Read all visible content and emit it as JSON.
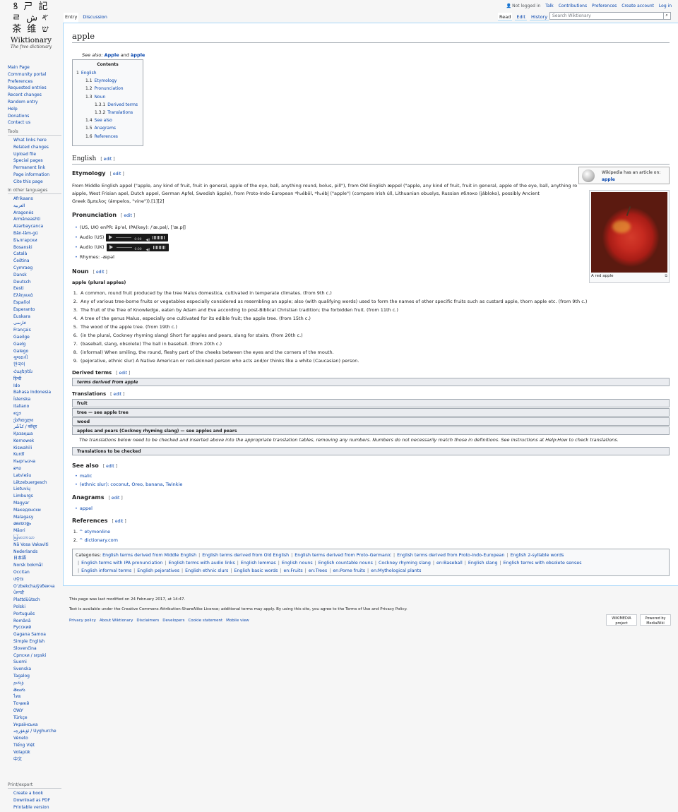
{
  "logo": {
    "glyphs1": "ꝸ ㄕ 記",
    "glyphs2": "ㄹ 𐤀 ش",
    "glyphs3": "茶 维 ש",
    "title": "Wiktionary",
    "subtitle": "The free dictionary"
  },
  "nav": [
    "Main Page",
    "Community portal",
    "Preferences",
    "Requested entries",
    "Recent changes",
    "Random entry",
    "Help",
    "Donations",
    "Contact us"
  ],
  "tools": {
    "heading": "Tools",
    "items": [
      "What links here",
      "Related changes",
      "Upload file",
      "Special pages",
      "Permanent link",
      "Page information",
      "Cite this page"
    ]
  },
  "languages": {
    "heading": "In other languages",
    "items": [
      "Afrikaans",
      "العربية",
      "Aragonés",
      "Armãneashti",
      "Azərbaycanca",
      "Bân-lâm-gú",
      "Български",
      "Bosanski",
      "Català",
      "Čeština",
      "Cymraeg",
      "Dansk",
      "Deutsch",
      "Eesti",
      "Ελληνικά",
      "Español",
      "Esperanto",
      "Euskara",
      "فارسی",
      "Français",
      "Gaeilge",
      "Gaelg",
      "Galego",
      "ગુજરાતી",
      "한국어",
      "Հայերեն",
      "हिन्दी",
      "Ido",
      "Bahasa Indonesia",
      "Íslenska",
      "Italiano",
      "ಕನ್ನಡ",
      "ქართული",
      "کٲشُر / कॉशुर",
      "Қазақша",
      "Kernowek",
      "Kiswahili",
      "Kurdî",
      "Кыргызча",
      "ລາວ",
      "Latviešu",
      "Lëtzebuergesch",
      "Lietuvių",
      "Limburgs",
      "Magyar",
      "Македонски",
      "Malagasy",
      "മലയാളം",
      "Māori",
      "မြန်မာဘာသာ",
      "Nā Vosa Vakaviti",
      "Nederlands",
      "日本語",
      "Norsk bokmål",
      "Occitan",
      "ଓଡ଼ିଆ",
      "Oʻzbekcha/ўзбекча",
      "ਪੰਜਾਬੀ",
      "Plattdüütsch",
      "Polski",
      "Português",
      "Română",
      "Русский",
      "Gagana Samoa",
      "Simple English",
      "Slovenčina",
      "Српски / srpski",
      "Suomi",
      "Svenska",
      "Tagalog",
      "தமிழ்",
      "తెలుగు",
      "ไทย",
      "Тоҷикӣ",
      "ᏣᎳᎩ",
      "Türkçe",
      "Українська",
      "ئۇيغۇرچە / Uyghurche",
      "Vèneto",
      "Tiếng Việt",
      "Volapük",
      "中文"
    ]
  },
  "print": {
    "heading": "Print/export",
    "items": [
      "Create a book",
      "Download as PDF",
      "Printable version"
    ]
  },
  "personal": {
    "not_logged": "Not logged in",
    "talk": "Talk",
    "contributions": "Contributions",
    "preferences": "Preferences",
    "create": "Create account",
    "login": "Log in"
  },
  "tabs": {
    "entry": "Entry",
    "discussion": "Discussion",
    "read": "Read",
    "edit": "Edit",
    "history": "History"
  },
  "search_placeholder": "Search Wiktionary",
  "page_title": "apple",
  "see_also_prefix": "See also:",
  "see_also_1": "Apple",
  "see_also_and": "and",
  "see_also_2": "àpple",
  "toc": {
    "title": "Contents",
    "items": [
      {
        "num": "1",
        "label": "English",
        "level": 1
      },
      {
        "num": "1.1",
        "label": "Etymology",
        "level": 2
      },
      {
        "num": "1.2",
        "label": "Pronunciation",
        "level": 2
      },
      {
        "num": "1.3",
        "label": "Noun",
        "level": 2
      },
      {
        "num": "1.3.1",
        "label": "Derived terms",
        "level": 3
      },
      {
        "num": "1.3.2",
        "label": "Translations",
        "level": 3
      },
      {
        "num": "1.4",
        "label": "See also",
        "level": 2
      },
      {
        "num": "1.5",
        "label": "Anagrams",
        "level": 2
      },
      {
        "num": "1.6",
        "label": "References",
        "level": 2
      }
    ]
  },
  "edit_label": "edit",
  "h_english": "English",
  "h_etymology": "Etymology",
  "etym_line1": "From Middle English appel (\"apple, any kind of fruit, fruit in general, apple of the eye, ball, anything round, bolus, pill\"), from Old English æppel (\"apple, any kind of fruit, fruit in general, apple of the eye, ball, anything round, bolus, pill\"), from Proto-Germanic *aplaz (\"apple\") (compare Scots",
  "etym_line2": "aipple, West Frisian apel, Dutch appel, German Apfel, Swedish äpple), from Proto-Indo-European *h₂ébōl, *h₂ébl̥ (\"apple\") (compare Irish úll, Lithuanian obuolys, Russian яблоко (jábloko), possibly Ancient",
  "etym_line3": "Greek ἄμπελος (ámpelos, \"vine\")).[1][2]",
  "wikibox": {
    "text": "Wikipedia has an article on:",
    "link": "apple"
  },
  "thumb_caption": "A red apple",
  "h_pron": "Pronunciation",
  "pron_ipa": "(US, UK) enPR: ăp'əl, IPA(key): /ˈæ.pəl/, [ˈæ.pl̩]",
  "audio_label": "Audio",
  "audio_us": "(US)",
  "audio_uk": "(UK)",
  "audio_time": "0:00",
  "rhymes": "Rhymes: -æpəl",
  "h_noun": "Noun",
  "headword": "apple (plural apples)",
  "defs": [
    "A common, round fruit produced by the tree Malus domestica, cultivated in temperate climates. (from 9th c.)",
    "Any of various tree-borne fruits or vegetables especially considered as resembling an apple; also (with qualifying words) used to form the names of other specific fruits such as custard apple, thorn apple etc. (from 9th c.)",
    "The fruit of the Tree of Knowledge, eaten by Adam and Eve according to post-Biblical Christian tradition; the forbidden fruit. (from 11th c.)",
    "A tree of the genus Malus, especially one cultivated for its edible fruit; the apple tree. (from 15th c.)",
    "The wood of the apple tree. (from 19th c.)",
    "(in the plural, Cockney rhyming slang) Short for apples and pears, slang for stairs. (from 20th c.)",
    "(baseball, slang, obsolete) The ball in baseball. (from 20th c.)",
    "(informal) When smiling, the round, fleshy part of the cheeks between the eyes and the corners of the mouth.",
    "(pejorative, ethnic slur) A Native American or red-skinned person who acts and/or thinks like a white (Caucasian) person."
  ],
  "h_derived": "Derived terms",
  "derived_box": "terms derived from apple",
  "h_trans": "Translations",
  "trans_boxes": [
    "fruit",
    "tree — see apple tree",
    "wood",
    "apples and pears (Cockney rhyming slang) — see apples and pears"
  ],
  "trans_note": "The translations below need to be checked and inserted above into the appropriate translation tables, removing any numbers. Numbers do not necessarily match those in definitions. See instructions at Help:How to check translations.",
  "trans_check": "Translations to be checked",
  "h_seealso": "See also",
  "seealso_items": [
    "malic",
    "(ethnic slur): coconut, Oreo, banana, Twinkie"
  ],
  "h_anagrams": "Anagrams",
  "anagrams": [
    "appel"
  ],
  "h_refs": "References",
  "refs": [
    "^ etymonline",
    "^ dictionary.com"
  ],
  "categories": {
    "label": "Categories:",
    "row1": [
      "English terms derived from Middle English",
      "English terms derived from Old English",
      "English terms derived from Proto-Germanic",
      "English terms derived from Proto-Indo-European",
      "English 2-syllable words"
    ],
    "row2": [
      "English terms with IPA pronunciation",
      "English terms with audio links",
      "English lemmas",
      "English nouns",
      "English countable nouns",
      "Cockney rhyming slang",
      "en:Baseball",
      "English slang",
      "English terms with obsolete senses"
    ],
    "row3": [
      "English informal terms",
      "English pejoratives",
      "English ethnic slurs",
      "English basic words",
      "en:Fruits",
      "en:Trees",
      "en:Pome fruits",
      "en:Mythological plants"
    ]
  },
  "footer": {
    "modified": "This page was last modified on 24 February 2017, at 14:47.",
    "license": "Text is available under the Creative Commons Attribution-ShareAlike License; additional terms may apply. By using this site, you agree to the Terms of Use and Privacy Policy.",
    "links": [
      "Privacy policy",
      "About Wiktionary",
      "Disclaimers",
      "Developers",
      "Cookie statement",
      "Mobile view"
    ],
    "badge1": "WIKIMEDIA project",
    "badge2": "Powered by MediaWiki"
  }
}
